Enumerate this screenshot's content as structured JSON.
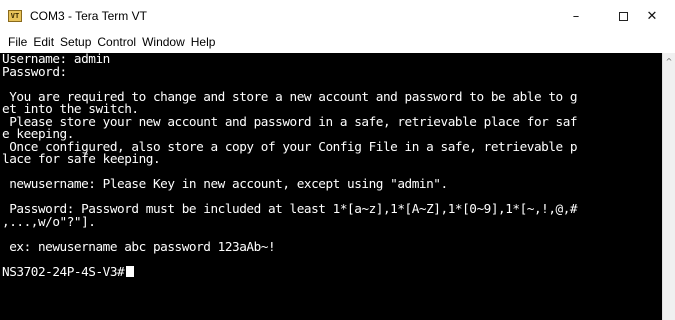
{
  "window": {
    "title": "COM3 - Tera Term VT",
    "icon_label": "VT",
    "icon": "tera-term-icon",
    "controls": {
      "minimize": "–",
      "maximize": "",
      "close": "✕"
    }
  },
  "menu": {
    "items": [
      "File",
      "Edit",
      "Setup",
      "Control",
      "Window",
      "Help"
    ]
  },
  "terminal": {
    "background": "#000000",
    "foreground": "#ffffff",
    "lines": [
      "Username: admin",
      "Password:",
      "",
      " You are required to change and store a new account and password to be able to g",
      "et into the switch.",
      " Please store your new account and password in a safe, retrievable place for saf",
      "e keeping.",
      " Once configured, also store a copy of your Config File in a safe, retrievable p",
      "lace for safe keeping.",
      "",
      " newusername: Please Key in new account, except using \"admin\".",
      "",
      " Password: Password must be included at least 1*[a~z],1*[A~Z],1*[0~9],1*[~,!,@,#",
      ",...,w/o\"?\"].",
      "",
      " ex: newusername abc password 123aAb~!",
      "",
      "NS3702-24P-4S-V3#"
    ]
  },
  "scrollbar": {
    "up_arrow": "^"
  }
}
